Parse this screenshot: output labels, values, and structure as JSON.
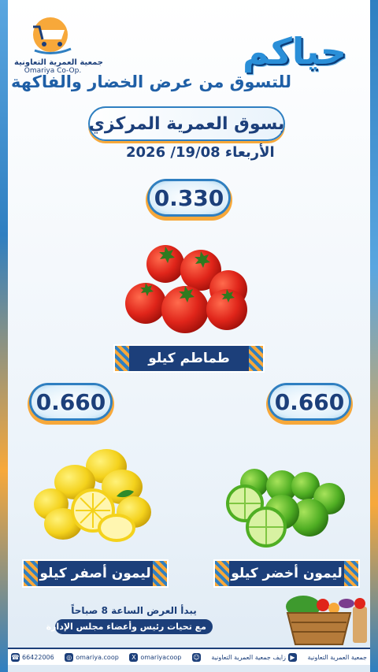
{
  "logo": {
    "arabic": "جمعية العمرية التعاونية",
    "english": "Omariya Co-Op."
  },
  "header": {
    "greeting": "حياكم",
    "subtitle": "للتسوق من عرض الخضار والفاكهة",
    "market": "بسوق العمرية المركزي",
    "date": "الأربعاء 19/08/ 2026"
  },
  "products": {
    "tomato": {
      "price": "0.330",
      "label": "طماطم كيلو"
    },
    "yellow_lemon": {
      "price": "0.660",
      "label": "ليمون أصفر كيلو"
    },
    "green_lemon": {
      "price": "0.660",
      "label": "ليمون أخضر كيلو"
    }
  },
  "footer": {
    "start_time": "يبدأ العرض الساعة 8 صباحاً",
    "greeting": "مع تحيات رئيس وأعضاء مجلس الإدارة"
  },
  "social": {
    "whatsapp": "66422006",
    "instagram": "omariya.coop",
    "x": "omariyacoop",
    "snapchat": "",
    "youtube": "زايف جمعية العمرية التعاونية",
    "site": "جمعية العمرية التعاونية"
  },
  "colors": {
    "navy": "#1c3f7a",
    "blue": "#2f7fc1",
    "orange": "#f7a83a"
  }
}
